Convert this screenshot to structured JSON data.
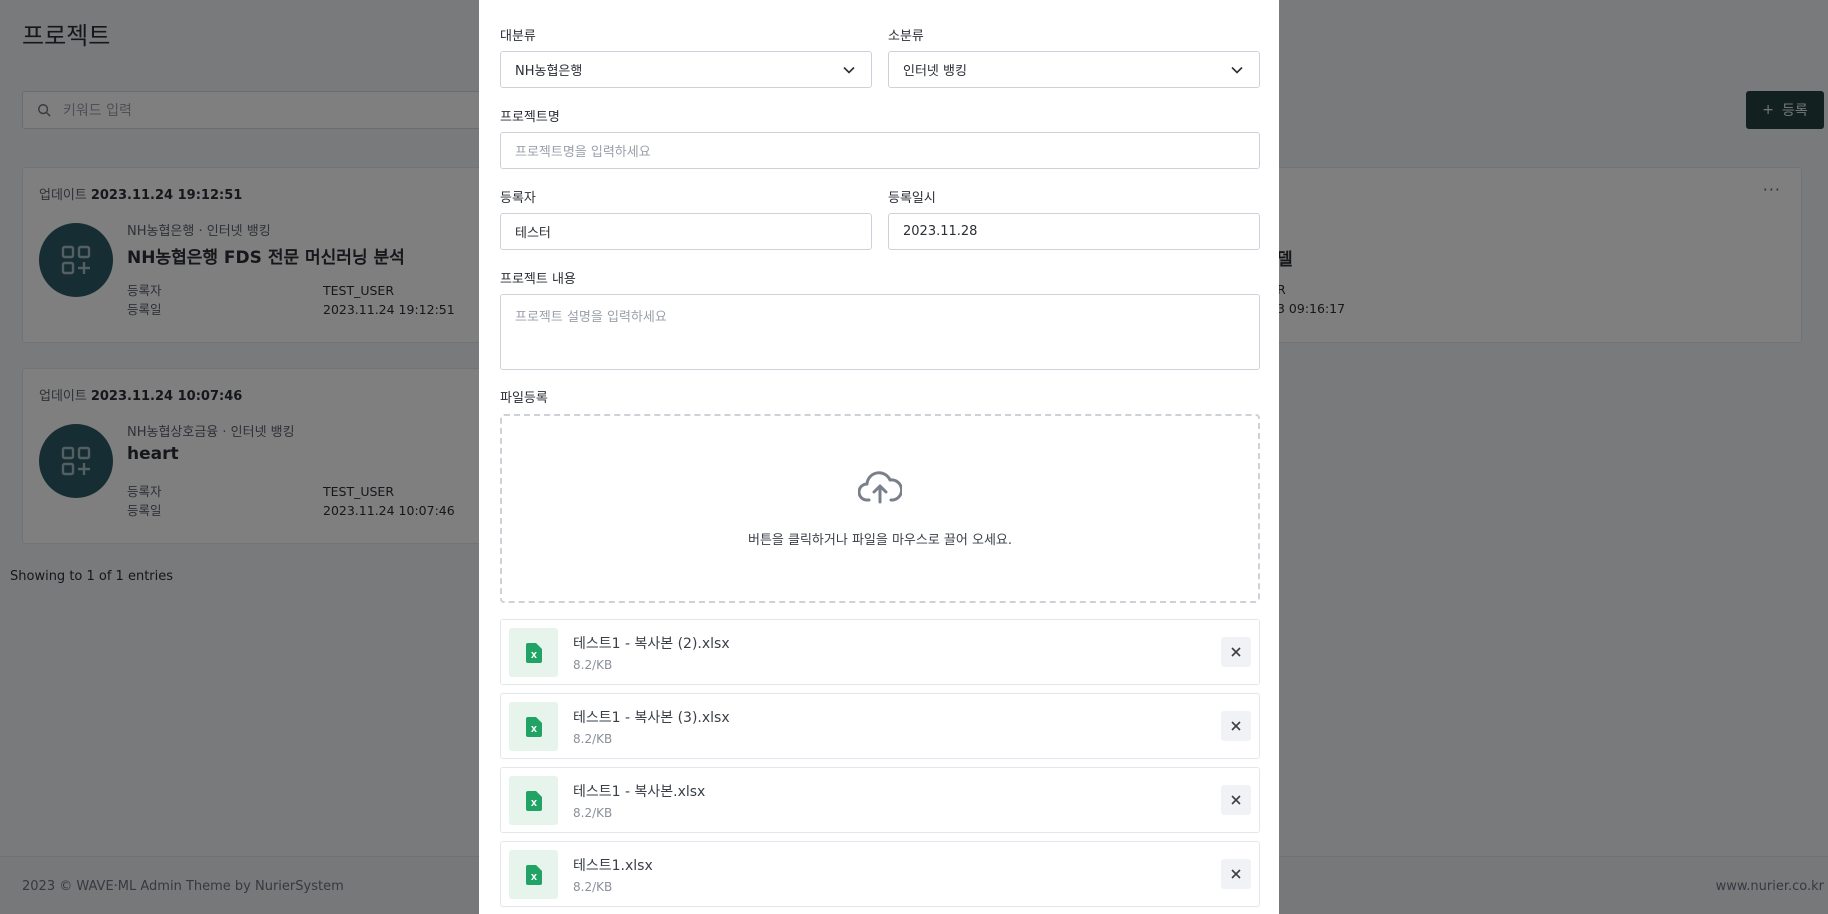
{
  "page": {
    "title": "프로젝트",
    "search_placeholder": "키워드 입력",
    "register_label": "등록",
    "showing": "Showing to 1 of 1 entries",
    "footer_left": "2023 © WAVE·ML Admin Theme by NurierSystem",
    "footer_right": "www.nurier.co.kr"
  },
  "cards": [
    {
      "update_label": "업데이트",
      "update_time": "2023.11.24 19:12:51",
      "category": "NH농협은행 · 인터넷 뱅킹",
      "name": "NH농협은행 FDS 전문 머신러닝 분석",
      "registrant_label": "등록자",
      "registrant": "TEST_USER",
      "date_label": "등록일",
      "date": "2023.11.24 19:12:51"
    },
    {
      "update_label": "업데이트",
      "update_time": "2023.11.24 10:07:46",
      "category": "NH농협상호금융 · 인터넷 뱅킹",
      "name": "heart",
      "registrant_label": "등록자",
      "registrant": "TEST_USER",
      "date_label": "등록일",
      "date": "2023.11.24 10:07:46"
    }
  ],
  "right_card": {
    "more": "···",
    "name_fragment": "델",
    "registrant_fragment": "R",
    "date_fragment": "3 09:16:17"
  },
  "modal": {
    "category_main_label": "대분류",
    "category_main_value": "NH농협은행",
    "category_sub_label": "소분류",
    "category_sub_value": "인터넷 뱅킹",
    "project_name_label": "프로젝트명",
    "project_name_placeholder": "프로젝트명을 입력하세요",
    "registrant_label": "등록자",
    "registrant_value": "테스터",
    "reg_date_label": "등록일시",
    "reg_date_value": "2023.11.28",
    "content_label": "프로젝트 내용",
    "content_placeholder": "프로젝트 설명을 입력하세요",
    "file_label": "파일등록",
    "dropzone_text": "버튼을 클릭하거나 파일을 마우스로 끌어 오세요.",
    "files": [
      {
        "name": "테스트1 - 복사본 (2).xlsx",
        "size": "8.2/KB",
        "icon": "X"
      },
      {
        "name": "테스트1 - 복사본 (3).xlsx",
        "size": "8.2/KB",
        "icon": "X"
      },
      {
        "name": "테스트1 - 복사본.xlsx",
        "size": "8.2/KB",
        "icon": "X"
      },
      {
        "name": "테스트1.xlsx",
        "size": "8.2/KB",
        "icon": "X"
      }
    ]
  },
  "colors": {
    "brand_dark": "#24423f",
    "avatar": "#2d5a66",
    "excel_green": "#21a366"
  }
}
